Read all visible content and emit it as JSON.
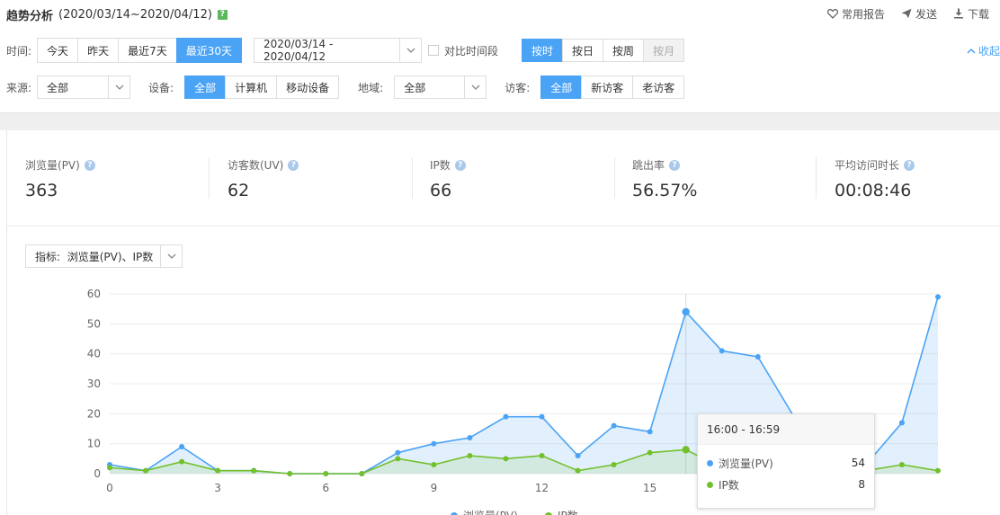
{
  "header": {
    "title": "趋势分析",
    "date_range": "(2020/03/14~2020/04/12)",
    "help_badge": "?",
    "actions": [
      {
        "label": "常用报告",
        "icon": "heart-icon"
      },
      {
        "label": "发送",
        "icon": "send-icon"
      },
      {
        "label": "下载",
        "icon": "download-icon"
      }
    ]
  },
  "filters": {
    "time_label": "时间:",
    "time_buttons": [
      "今天",
      "昨天",
      "最近7天",
      "最近30天"
    ],
    "time_active": 3,
    "date_picker_value": "2020/03/14 - 2020/04/12",
    "compare_label": "对比时间段",
    "granularity_buttons": [
      "按时",
      "按日",
      "按周",
      "按月"
    ],
    "granularity_active": 0,
    "granularity_disabled": 3,
    "collapse_label": "收起",
    "source_label": "来源:",
    "source_value": "全部",
    "device_label": "设备:",
    "device_buttons": [
      "全部",
      "计算机",
      "移动设备"
    ],
    "device_active": 0,
    "region_label": "地域:",
    "region_value": "全部",
    "visitor_label": "访客:",
    "visitor_buttons": [
      "全部",
      "新访客",
      "老访客"
    ],
    "visitor_active": 0
  },
  "stats": [
    {
      "name": "浏览量(PV)",
      "value": "363"
    },
    {
      "name": "访客数(UV)",
      "value": "62"
    },
    {
      "name": "IP数",
      "value": "66"
    },
    {
      "name": "跳出率",
      "value": "56.57%"
    },
    {
      "name": "平均访问时长",
      "value": "00:08:46"
    }
  ],
  "metric_select": {
    "prefix": "指标:",
    "value": "浏览量(PV)、IP数"
  },
  "tooltip": {
    "title": "16:00 - 16:59",
    "rows": [
      {
        "name": "浏览量(PV)",
        "value": "54",
        "color": "#4aa3f5"
      },
      {
        "name": "IP数",
        "value": "8",
        "color": "#72c02c"
      }
    ]
  },
  "colors": {
    "accent": "#4aa3f5",
    "pv": "#4aa3f5",
    "ip": "#72c02c"
  },
  "chart_data": {
    "type": "area",
    "x": [
      0,
      1,
      2,
      3,
      4,
      5,
      6,
      7,
      8,
      9,
      10,
      11,
      12,
      13,
      14,
      15,
      16,
      17,
      18,
      19,
      20,
      21,
      22,
      23
    ],
    "x_ticks": [
      0,
      3,
      6,
      9,
      12,
      15,
      18
    ],
    "ylim": [
      0,
      60
    ],
    "y_ticks": [
      0,
      10,
      20,
      30,
      40,
      50,
      60
    ],
    "grid": true,
    "legend": "bottom",
    "series": [
      {
        "name": "浏览量(PV)",
        "color": "#4aa3f5",
        "values": [
          3,
          1,
          9,
          1,
          1,
          0,
          0,
          0,
          7,
          10,
          12,
          19,
          19,
          6,
          16,
          14,
          54,
          41,
          39,
          19,
          13,
          3,
          17,
          59
        ]
      },
      {
        "name": "IP数",
        "color": "#72c02c",
        "values": [
          2,
          1,
          4,
          1,
          1,
          0,
          0,
          0,
          5,
          3,
          6,
          5,
          6,
          1,
          3,
          7,
          8,
          2,
          1,
          1,
          4,
          1,
          3,
          1
        ]
      }
    ],
    "highlight_index": 16
  }
}
